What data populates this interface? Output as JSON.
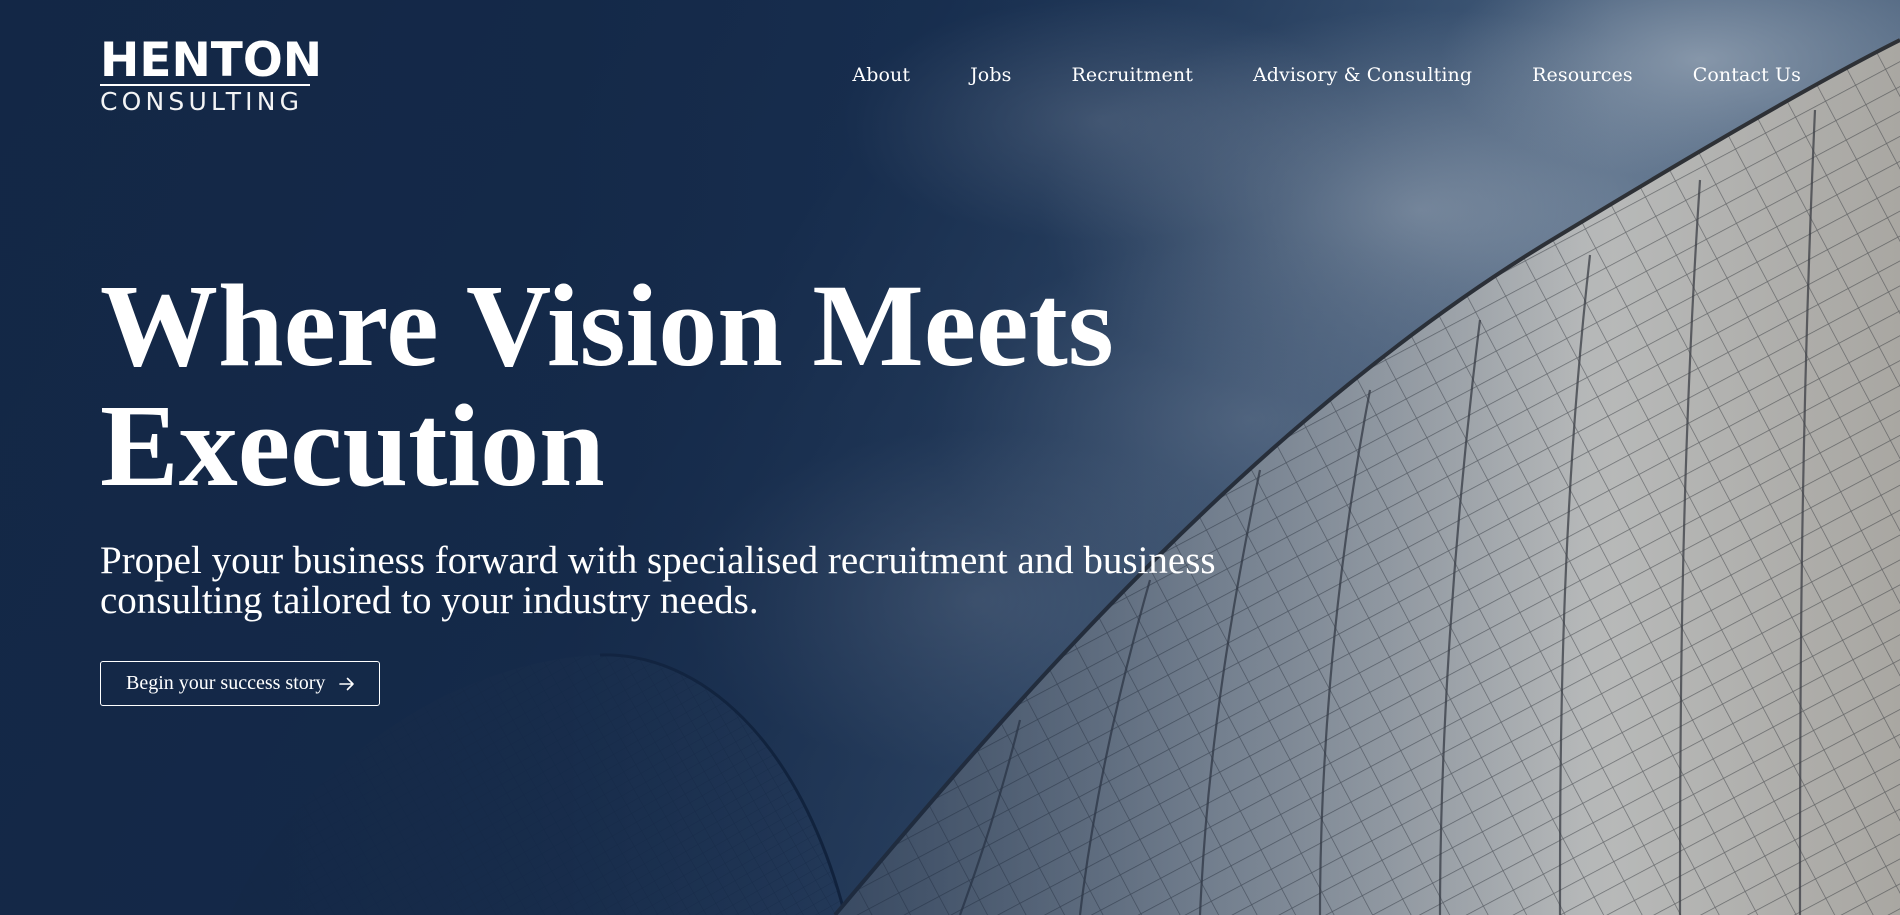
{
  "brand": {
    "name": "HENTON",
    "tagline": "CONSULTING"
  },
  "nav": {
    "items": [
      {
        "label": "About"
      },
      {
        "label": "Jobs"
      },
      {
        "label": "Recruitment"
      },
      {
        "label": "Advisory & Consulting"
      },
      {
        "label": "Resources"
      },
      {
        "label": "Contact Us"
      }
    ]
  },
  "hero": {
    "headline": "Where Vision Meets Execution",
    "subheadline": "Propel your business forward with specialised recruitment and business consulting tailored to your industry needs.",
    "cta_label": "Begin your success story",
    "cta_icon": "arrow-right-icon",
    "background_description_icon": "building-facade-image"
  },
  "colors": {
    "navy": "#15294a",
    "text": "#ffffff"
  }
}
